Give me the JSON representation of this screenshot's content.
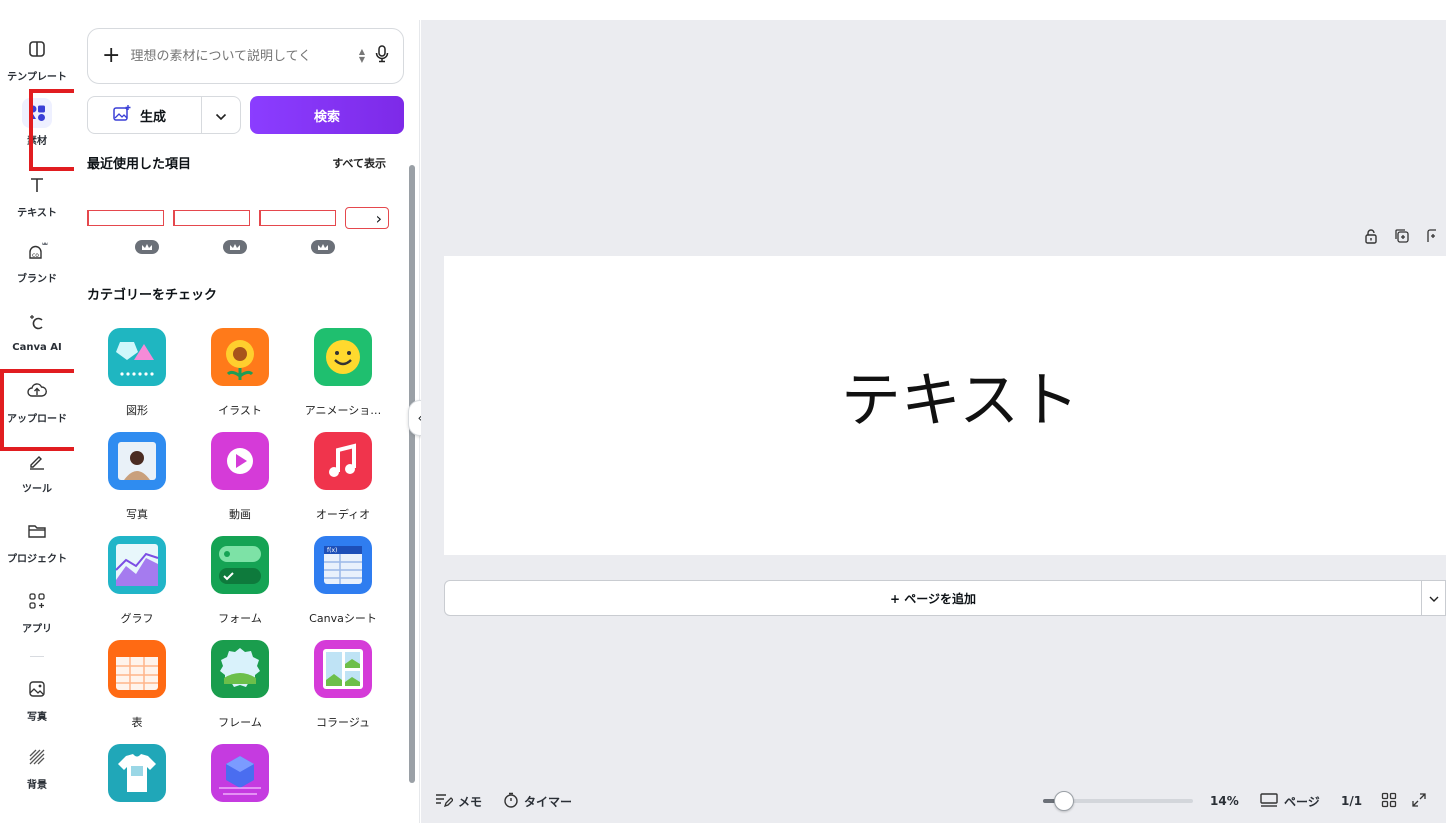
{
  "rail": {
    "items": [
      {
        "label": "テンプレート",
        "icon": "template-icon"
      },
      {
        "label": "素材",
        "icon": "elements-icon"
      },
      {
        "label": "テキスト",
        "icon": "text-icon"
      },
      {
        "label": "ブランド",
        "icon": "brand-icon"
      },
      {
        "label": "Canva AI",
        "icon": "canva-ai-icon"
      },
      {
        "label": "アップロード",
        "icon": "upload-icon"
      },
      {
        "label": "ツール",
        "icon": "tools-icon"
      },
      {
        "label": "プロジェクト",
        "icon": "folder-icon"
      },
      {
        "label": "アプリ",
        "icon": "apps-icon"
      },
      {
        "label": "写真",
        "icon": "photo-icon"
      },
      {
        "label": "背景",
        "icon": "background-icon"
      }
    ]
  },
  "panel": {
    "search_placeholder": "理想の素材について説明してく",
    "generate_label": "生成",
    "search_button": "検索",
    "recent_title": "最近使用した項目",
    "see_all": "すべて表示",
    "categories_title": "カテゴリーをチェック",
    "categories": [
      {
        "label": "図形",
        "color": "#1fb6c1"
      },
      {
        "label": "イラスト",
        "color": "#ff7a1a"
      },
      {
        "label": "アニメーショ…",
        "color": "#1fbf6f"
      },
      {
        "label": "写真",
        "color": "#2f8cf0"
      },
      {
        "label": "動画",
        "color": "#d53bd8"
      },
      {
        "label": "オーディオ",
        "color": "#f0344c"
      },
      {
        "label": "グラフ",
        "color": "#21b5c8"
      },
      {
        "label": "フォーム",
        "color": "#15a354"
      },
      {
        "label": "Canvaシート",
        "color": "#2f7df0"
      },
      {
        "label": "表",
        "color": "#ff6a13"
      },
      {
        "label": "フレーム",
        "color": "#1a9d4d"
      },
      {
        "label": "コラージュ",
        "color": "#d53bd8"
      },
      {
        "label": "",
        "color": "#20a7b8"
      },
      {
        "label": "",
        "color": "#c53be0"
      }
    ]
  },
  "canvas": {
    "page_text": "テキスト",
    "add_page": "+ ページを追加"
  },
  "bottombar": {
    "notes": "メモ",
    "timer": "タイマー",
    "zoom": "14%",
    "zoom_fraction": 0.14,
    "pages_label": "ページ",
    "page_count": "1/1"
  }
}
